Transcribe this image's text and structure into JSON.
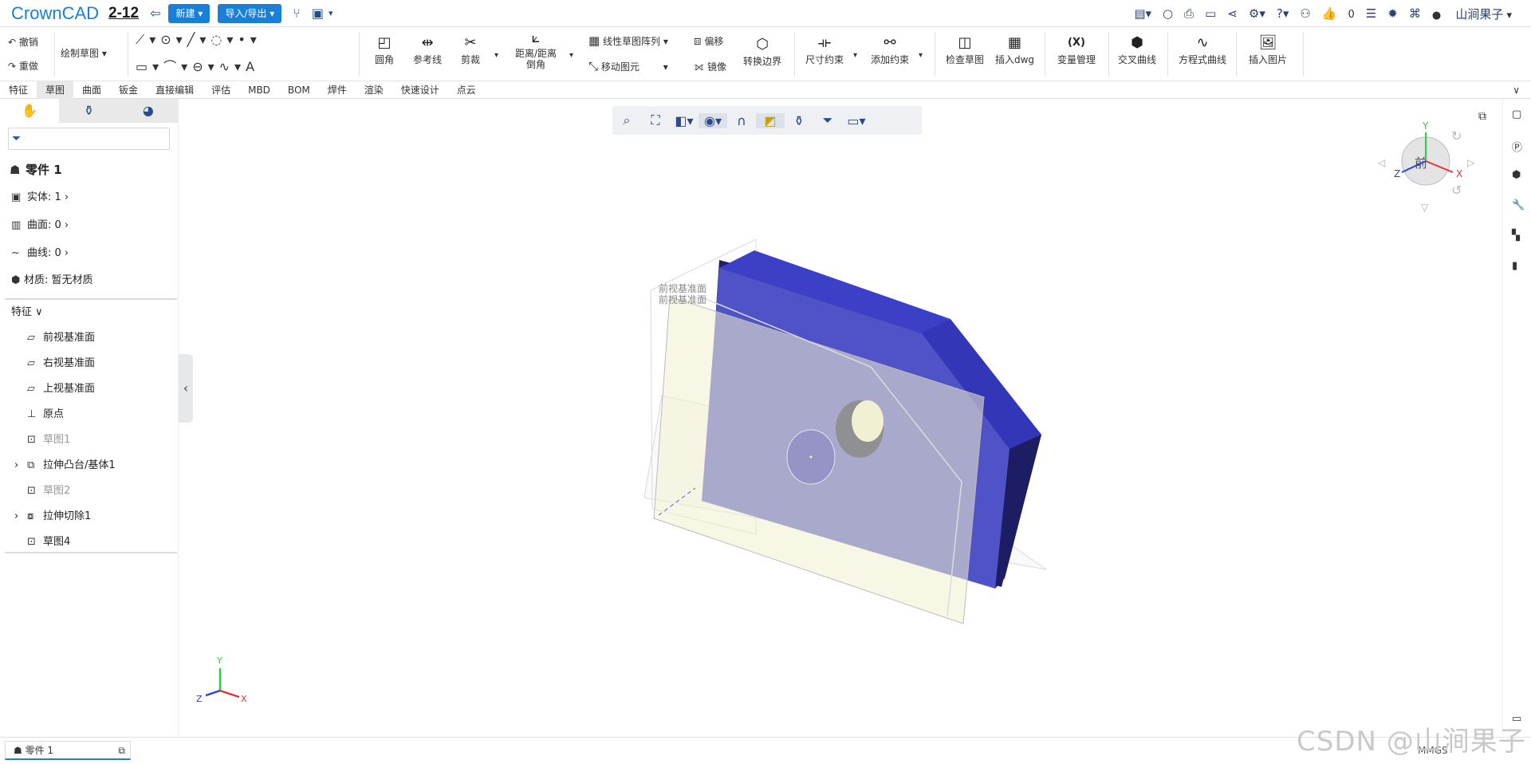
{
  "app": {
    "logo": "CrownCAD",
    "doc": "2-12",
    "new_label": "新建",
    "import_label": "导入/导出",
    "likes": "0",
    "user": "山涧果子"
  },
  "undo": {
    "undo": "撤销",
    "redo": "重做",
    "sketch_mode": "绘制草图"
  },
  "ribbon": {
    "fillet": "圆角",
    "refline": "参考线",
    "trim": "剪裁",
    "chamfer1": "距离/距离",
    "chamfer2": "倒角",
    "linear_pattern": "线性草图阵列",
    "offset": "偏移",
    "move": "移动图元",
    "mirror": "镜像",
    "convert": "转换边界",
    "dim": "尺寸约束",
    "add_constraint": "添加约束",
    "check": "检查草图",
    "insert_dwg": "插入dwg",
    "var_mgr": "变量管理",
    "var_icon": "(X)",
    "intersect": "交叉曲线",
    "eq_curve": "方程式曲线",
    "insert_img": "插入图片"
  },
  "tabs": [
    "特征",
    "草图",
    "曲面",
    "钣金",
    "直接编辑",
    "评估",
    "MBD",
    "BOM",
    "焊件",
    "渲染",
    "快速设计",
    "点云"
  ],
  "tree": {
    "part": "零件 1",
    "solids": "实体: 1",
    "surfaces": "曲面: 0",
    "curves": "曲线: 0",
    "material": "材质: 暂无材质",
    "features": "特征",
    "items": [
      "前视基准面",
      "右视基准面",
      "上视基准面",
      "原点",
      "草图1",
      "拉伸凸台/基体1",
      "草图2",
      "拉伸切除1",
      "草图4"
    ]
  },
  "viewport": {
    "plane_label1": "前视基准面",
    "plane_label2": "前视基准面",
    "cube_face": "前",
    "axis_x": "X",
    "axis_y": "Y",
    "axis_z": "Z"
  },
  "bottom": {
    "tab": "零件 1",
    "units": "MMGS",
    "watermark": "CSDN @山涧果子"
  },
  "colors": {
    "brand": "#1a7fd6",
    "solid": "#3a3fc8",
    "plane": "#f3f1d0"
  }
}
